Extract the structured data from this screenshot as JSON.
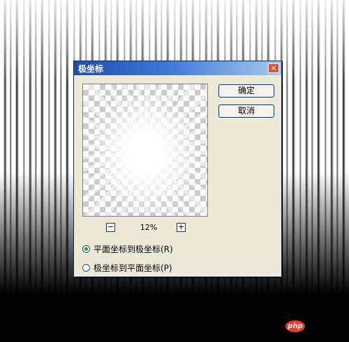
{
  "dialog": {
    "title": "极坐标",
    "close_glyph": "×",
    "ok_label": "确定",
    "cancel_label": "取消"
  },
  "preview": {
    "zoom_minus": "−",
    "zoom_plus": "+",
    "zoom_level": "12%"
  },
  "options": [
    {
      "label": "平面坐标到极坐标(R)",
      "checked": true
    },
    {
      "label": "极坐标到平面坐标(P)",
      "checked": false
    }
  ],
  "watermark": {
    "text": "php"
  },
  "colors": {
    "title_bar": "#1e4fae",
    "dialog_bg": "#ece9d8",
    "radio_selected": "#21a121",
    "watermark": "#e63b2e"
  }
}
